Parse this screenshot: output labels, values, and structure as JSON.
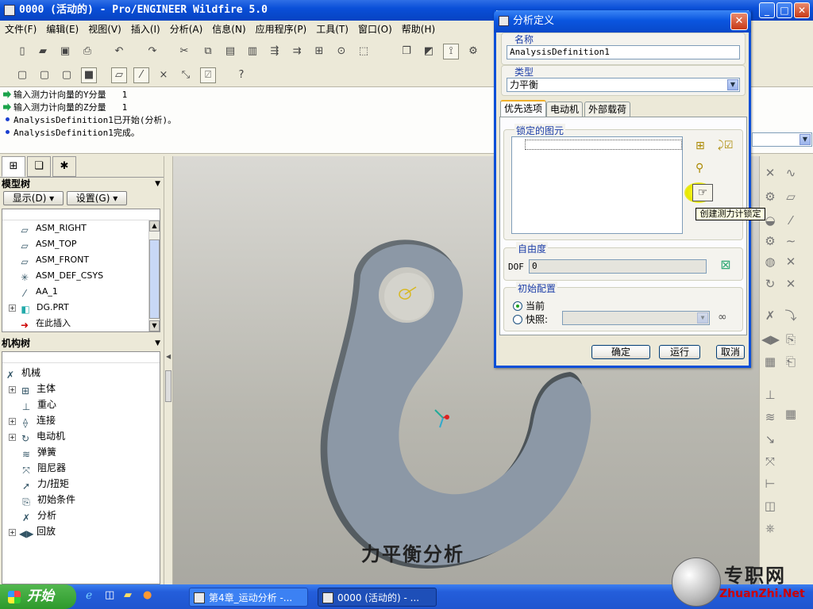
{
  "window": {
    "title": "0000 (活动的) - Pro/ENGINEER Wildfire 5.0",
    "min": "_",
    "max": "□",
    "close": "✕"
  },
  "menu": [
    "文件(F)",
    "编辑(E)",
    "视图(V)",
    "插入(I)",
    "分析(A)",
    "信息(N)",
    "应用程序(P)",
    "工具(T)",
    "窗口(O)",
    "帮助(H)"
  ],
  "messages": [
    {
      "type": "prompt",
      "text": "输入测力计向量的Y分量",
      "value": "1"
    },
    {
      "type": "prompt",
      "text": "输入测力计向量的Z分量",
      "value": "1"
    },
    {
      "type": "info",
      "text": "AnalysisDefinition1已开始(分析)。"
    },
    {
      "type": "info",
      "text": "AnalysisDefinition1完成。"
    }
  ],
  "model_tree": {
    "header": "模型树",
    "show_btn": "显示(D) ▾",
    "settings_btn": "设置(G) ▾",
    "items": [
      {
        "label": "ASM_RIGHT",
        "icon": "datum-plane-icon"
      },
      {
        "label": "ASM_TOP",
        "icon": "datum-plane-icon"
      },
      {
        "label": "ASM_FRONT",
        "icon": "datum-plane-icon"
      },
      {
        "label": "ASM_DEF_CSYS",
        "icon": "csys-icon"
      },
      {
        "label": "AA_1",
        "icon": "axis-icon"
      },
      {
        "label": "DG.PRT",
        "icon": "part-icon"
      },
      {
        "label": "在此插入",
        "icon": "insert-arrow-icon"
      }
    ]
  },
  "mech_tree": {
    "header": "机构树",
    "root": "机械",
    "items": [
      "主体",
      "重心",
      "连接",
      "电动机",
      "弹簧",
      "阻尼器",
      "力/扭矩",
      "初始条件",
      "分析",
      "回放"
    ]
  },
  "subtitle": "力平衡分析",
  "dialog": {
    "title": "分析定义",
    "name_label": "名称",
    "name_value": "AnalysisDefinition1",
    "type_label": "类型",
    "type_value": "力平衡",
    "tabs": [
      "优先选项",
      "电动机",
      "外部载荷"
    ],
    "locked_label": "锁定的图元",
    "tooltip": "创建测力计锁定",
    "dof_group": "自由度",
    "dof_label": "DOF",
    "dof_value": "0",
    "init_group": "初始配置",
    "radio_current": "当前",
    "radio_snapshot": "快照:",
    "ok": "确定",
    "run": "运行",
    "cancel": "取消"
  },
  "taskbar": {
    "start": "开始",
    "task1": "第4章_运动分析 -...",
    "task2": "0000 (活动的) - ..."
  },
  "watermark": {
    "brand": "专职网",
    "url": "ZhuanZhi.Net"
  }
}
